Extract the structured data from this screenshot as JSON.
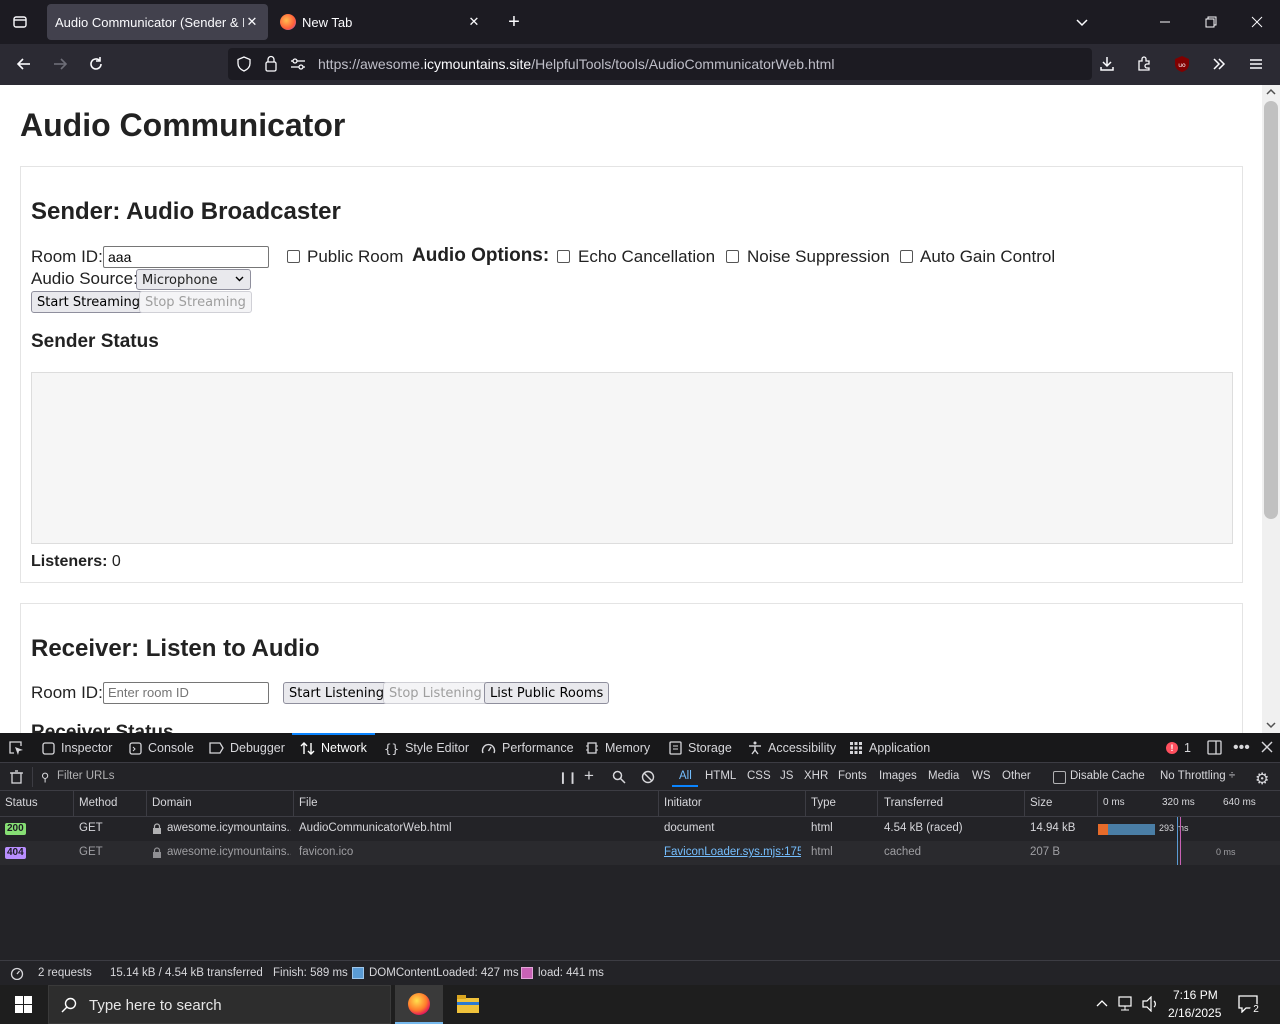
{
  "browser": {
    "tabs": [
      {
        "title": "Audio Communicator (Sender & Re",
        "active": true
      },
      {
        "title": "New Tab",
        "active": false
      }
    ],
    "url": {
      "prefix": "https://awesome.",
      "host": "icymountains.site",
      "path": "/HelpfulTools/tools/AudioCommunicatorWeb.html"
    }
  },
  "page": {
    "title": "Audio Communicator",
    "sender": {
      "heading": "Sender: Audio Broadcaster",
      "room_id_label": "Room ID:",
      "room_id_value": "aaa",
      "public_room_label": "Public Room",
      "audio_options_label": "Audio Options:",
      "echo_label": "Echo Cancellation",
      "noise_label": "Noise Suppression",
      "gain_label": "Auto Gain Control",
      "audio_source_label": "Audio Source:",
      "audio_source_value": "Microphone",
      "start_button": "Start Streaming",
      "stop_button": "Stop Streaming",
      "status_heading": "Sender Status",
      "listeners_label": "Listeners:",
      "listeners_value": "0"
    },
    "receiver": {
      "heading": "Receiver: Listen to Audio",
      "room_id_label": "Room ID:",
      "room_id_placeholder": "Enter room ID",
      "start_button": "Start Listening",
      "stop_button": "Stop Listening",
      "list_button": "List Public Rooms",
      "status_heading": "Receiver Status"
    }
  },
  "devtools": {
    "tabs": [
      "Inspector",
      "Console",
      "Debugger",
      "Network",
      "Style Editor",
      "Performance",
      "Memory",
      "Storage",
      "Accessibility",
      "Application"
    ],
    "active_tab": "Network",
    "error_count": "1",
    "filter_placeholder": "Filter URLs",
    "type_filters": [
      "All",
      "HTML",
      "CSS",
      "JS",
      "XHR",
      "Fonts",
      "Images",
      "Media",
      "WS",
      "Other"
    ],
    "disable_cache": "Disable Cache",
    "throttling": "No Throttling ÷",
    "columns": [
      "Status",
      "Method",
      "Domain",
      "File",
      "Initiator",
      "Type",
      "Transferred",
      "Size"
    ],
    "timeline_ticks": [
      "0 ms",
      "320 ms",
      "640 ms"
    ],
    "rows": [
      {
        "status": "200",
        "method": "GET",
        "domain": "awesome.icymountains...",
        "file": "AudioCommunicatorWeb.html",
        "initiator": "document",
        "type": "html",
        "transferred": "4.54 kB (raced)",
        "size": "14.94 kB",
        "timing": "293 ms"
      },
      {
        "status": "404",
        "method": "GET",
        "domain": "awesome.icymountains...",
        "file": "favicon.ico",
        "initiator": "FaviconLoader.sys.mjs:175...",
        "type": "html",
        "transferred": "cached",
        "size": "207 B",
        "timing": "0 ms"
      }
    ],
    "footer": {
      "requests": "2 requests",
      "transferred": "15.14 kB / 4.54 kB transferred",
      "finish": "Finish: 589 ms",
      "dom": "DOMContentLoaded: 427 ms",
      "load": "load: 441 ms"
    },
    "colors": {
      "status_ok": "#86de74",
      "status_404": "#b98eff",
      "dom_marker": "#5a9bd4",
      "load_marker": "#c862b5"
    }
  },
  "taskbar": {
    "search_placeholder": "Type here to search",
    "time": "7:16 PM",
    "date": "2/16/2025",
    "notifications": "2"
  }
}
